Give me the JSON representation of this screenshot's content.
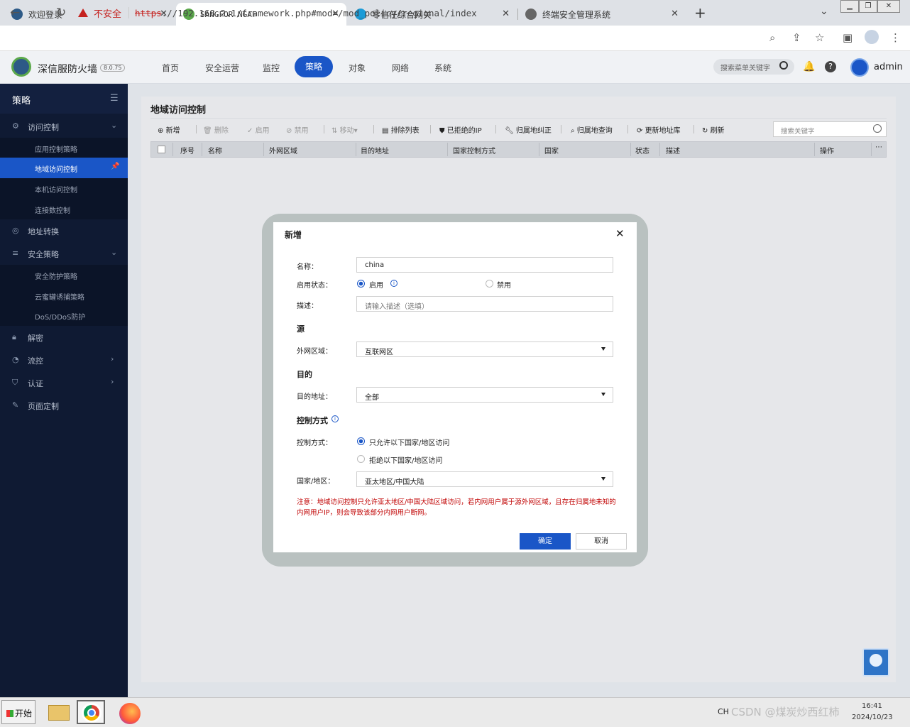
{
  "browser": {
    "tabs": [
      {
        "title": "欢迎登录",
        "color": "#2d5a87"
      },
      {
        "title": "SANGFOR NGAF",
        "color": "#5ba84b"
      },
      {
        "title": "零信任综合网关",
        "color": "#1a9bd7"
      },
      {
        "title": "终端安全管理系统",
        "color": "#666666"
      }
    ],
    "new_tab": "+",
    "insecure_label": "不安全",
    "url_protocol": "https",
    "url_rest": "://192.168.2.1/framework.php#mod=/mod_policy/regional/index"
  },
  "header": {
    "brand": "深信服防火墙",
    "version": "8.0.75",
    "nav": [
      "首页",
      "安全运营",
      "监控",
      "策略",
      "对象",
      "网络",
      "系统"
    ],
    "active_nav": "策略",
    "search_placeholder": "搜索菜单关键字",
    "username": "admin"
  },
  "sidebar": {
    "title": "策略",
    "groups": [
      {
        "label": "访问控制",
        "items": [
          "应用控制策略",
          "地域访问控制",
          "本机访问控制",
          "连接数控制"
        ]
      },
      {
        "label": "地址转换",
        "items": []
      },
      {
        "label": "安全策略",
        "items": [
          "安全防护策略",
          "云蜜罐诱捕策略",
          "DoS/DDoS防护"
        ]
      },
      {
        "label": "解密",
        "items": []
      },
      {
        "label": "流控",
        "items": []
      },
      {
        "label": "认证",
        "items": []
      },
      {
        "label": "页面定制",
        "items": []
      }
    ],
    "active_item": "地域访问控制"
  },
  "page": {
    "title": "地域访问控制",
    "toolbar": {
      "add": "新增",
      "delete": "删除",
      "enable": "启用",
      "disable": "禁用",
      "move": "移动",
      "exclude": "排除列表",
      "blocked_ip": "已拒绝的IP",
      "correction": "归属地纠正",
      "lookup": "归属地查询",
      "update": "更新地址库",
      "refresh": "刷新"
    },
    "search_placeholder": "搜索关键字",
    "columns": [
      "序号",
      "名称",
      "外网区域",
      "目的地址",
      "国家控制方式",
      "国家",
      "状态",
      "描述",
      "操作"
    ]
  },
  "modal": {
    "title": "新增",
    "name_label": "名称：",
    "name_value": "china",
    "status_label": "启用状态：",
    "status_on": "启用",
    "status_off": "禁用",
    "desc_label": "描述：",
    "desc_placeholder": "请输入描述（选填）",
    "section_source": "源",
    "zone_label": "外网区域：",
    "zone_value": "互联网区",
    "section_dest": "目的",
    "dest_label": "目的地址：",
    "dest_value": "全部",
    "section_control": "控制方式",
    "control_label": "控制方式：",
    "control_allow": "只允许以下国家/地区访问",
    "control_deny": "拒绝以下国家/地区访问",
    "country_label": "国家/地区：",
    "country_value": "亚太地区/中国大陆",
    "note": "注意：地域访问控制只允许亚太地区/中国大陆区域访问，若内网用户属于源外网区域，且存在归属地未知的内网用户IP，则会导致该部分内网用户断网。",
    "ok": "确定",
    "cancel": "取消"
  },
  "taskbar": {
    "start": "开始",
    "lang": "CH",
    "watermark": "CSDN @煤炭炒西红柿",
    "time": "16:41",
    "date": "2024/10/23"
  },
  "colors": {
    "accent": "#1a56c7",
    "sidebar": "#0f1a33",
    "warning": "#c00000"
  }
}
